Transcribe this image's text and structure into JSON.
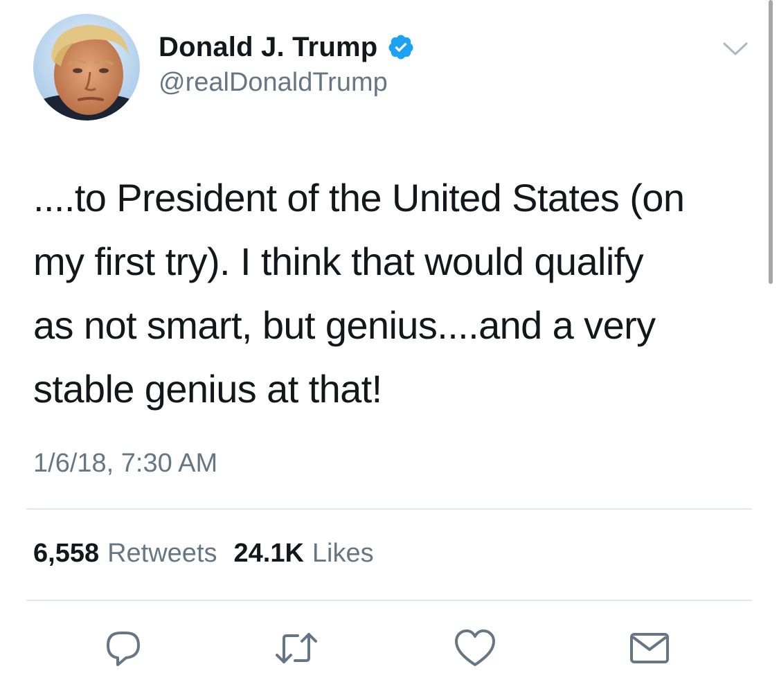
{
  "user": {
    "display_name": "Donald J. Trump",
    "handle": "@realDonaldTrump",
    "verified": true,
    "avatar_icon": "user-avatar"
  },
  "tweet": {
    "text_lines": [
      "....to President of the United States (on",
      "my first try). I think that would qualify",
      "as not smart, but genius....and a very",
      "stable genius at that!"
    ],
    "timestamp": "1/6/18, 7:30 AM"
  },
  "stats": {
    "retweets_count": "6,558",
    "retweets_label": "Retweets",
    "likes_count": "24.1K",
    "likes_label": "Likes"
  },
  "actions": [
    {
      "name": "reply",
      "icon": "reply-icon"
    },
    {
      "name": "retweet",
      "icon": "retweet-icon"
    },
    {
      "name": "like",
      "icon": "heart-icon"
    },
    {
      "name": "direct-message",
      "icon": "envelope-icon"
    }
  ],
  "colors": {
    "text_primary": "#14171a",
    "text_secondary": "#657786",
    "verified_blue": "#1da1f2",
    "icon_gray": "#657786",
    "divider": "#e1e8ed"
  }
}
